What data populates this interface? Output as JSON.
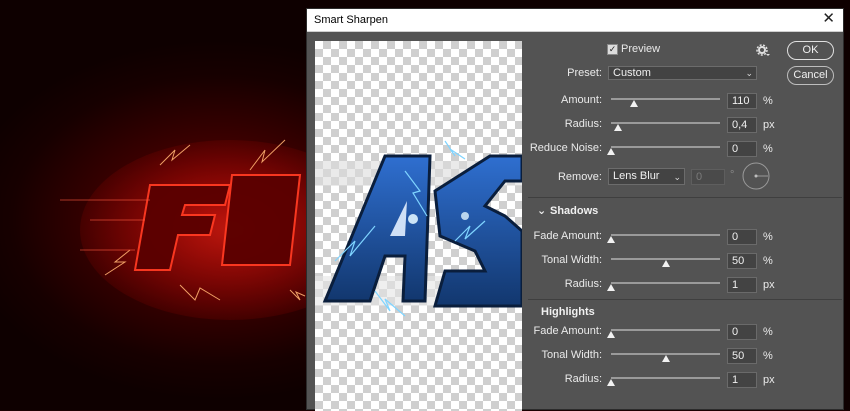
{
  "dialog": {
    "title": "Smart Sharpen",
    "close_glyph": "✕",
    "preview_label": "Preview",
    "preview_checked": true,
    "ok_label": "OK",
    "cancel_label": "Cancel",
    "preset_label": "Preset:",
    "preset_value": "Custom",
    "settings_icon": "gear-icon",
    "main": {
      "amount": {
        "label": "Amount:",
        "value": "110",
        "unit": "%",
        "level": 0.22
      },
      "radius": {
        "label": "Radius:",
        "value": "0,4",
        "unit": "px",
        "level": 0.06
      },
      "reduce_noise": {
        "label": "Reduce Noise:",
        "value": "0",
        "unit": "%",
        "level": 0.0
      }
    },
    "remove": {
      "label": "Remove:",
      "value": "Lens Blur",
      "angle_value": "0",
      "angle_unit": "°"
    },
    "shadows": {
      "header": "Shadows",
      "fade_amount": {
        "label": "Fade Amount:",
        "value": "0",
        "unit": "%",
        "level": 0.0
      },
      "tonal_width": {
        "label": "Tonal Width:",
        "value": "50",
        "unit": "%",
        "level": 0.5
      },
      "radius": {
        "label": "Radius:",
        "value": "1",
        "unit": "px",
        "level": 0.0
      }
    },
    "highlights": {
      "header": "Highlights",
      "fade_amount": {
        "label": "Fade Amount:",
        "value": "0",
        "unit": "%",
        "level": 0.0
      },
      "tonal_width": {
        "label": "Tonal Width:",
        "value": "50",
        "unit": "%",
        "level": 0.5
      },
      "radius": {
        "label": "Radius:",
        "value": "1",
        "unit": "px",
        "level": 0.0
      }
    }
  },
  "colors": {
    "dialog_bg": "#535353",
    "field_bg": "#434343",
    "background_glow": "#c40000",
    "preview_text": "#1d56a8"
  }
}
